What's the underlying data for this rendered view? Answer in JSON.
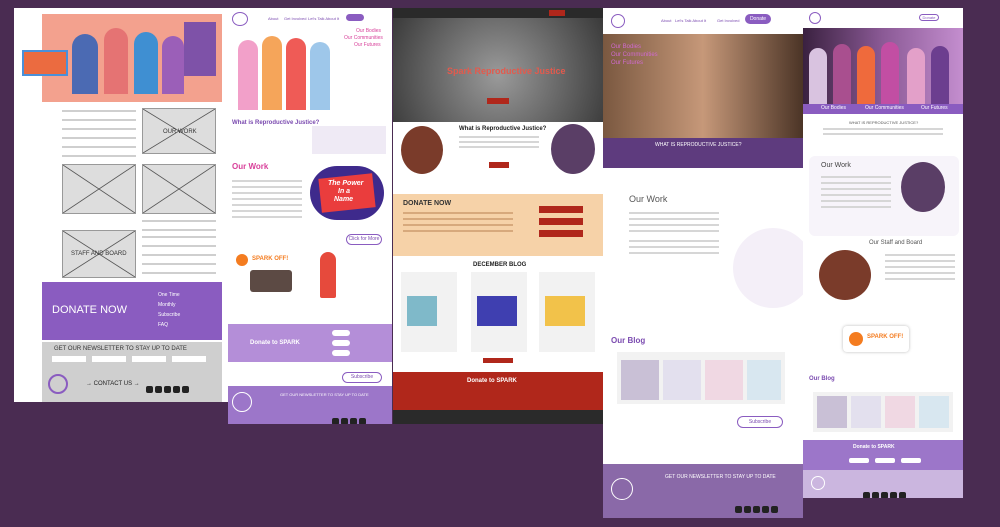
{
  "wireframe": {
    "our_work": "OUR WORK",
    "staff_board": "STAFF AND BOARD",
    "donate_now": "DONATE NOW",
    "donate_options": [
      "One Time",
      "Monthly",
      "Subscribe",
      "FAQ"
    ],
    "newsletter": "GET OUR NEWSLETTER TO STAY UP TO DATE",
    "logo": "SPARK",
    "contact": "→ CONTACT US →"
  },
  "page2": {
    "logo": "SPARK",
    "nav": [
      "About",
      "Get Involved",
      "Let's Talk About It",
      "Donate"
    ],
    "taglines": [
      "Our Bodies",
      "Our Communities",
      "Our Futures"
    ],
    "heading_rj": "What is Reproductive Justice?",
    "our_work": "Our Work",
    "power_line1": "The Power",
    "power_line2": "In a",
    "power_line3": "Name",
    "click_more": "Click for More",
    "podcast": "SPARK OFF!",
    "donate": "Donate to SPARK",
    "subscribe": "Subscribe",
    "newsletter": "GET OUR NEWSLETTER TO STAY UP TO DATE"
  },
  "page3": {
    "hero_title": "Spark Reproductive Justice",
    "heading_rj": "What is Reproductive Justice?",
    "donate_now": "DONATE NOW",
    "blog": "DECEMBER BLOG",
    "donate": "Donate to SPARK"
  },
  "page4": {
    "logo": "SPARK",
    "nav": [
      "About",
      "Let's Talk About It",
      "Get Involved"
    ],
    "donate_btn": "Donate",
    "taglines": [
      "Our Bodies",
      "Our Communities",
      "Our Futures"
    ],
    "heading_rj": "WHAT IS REPRODUCTIVE JUSTICE?",
    "our_work": "Our Work",
    "blog": "Our Blog",
    "subscribe": "Subscribe",
    "newsletter": "GET OUR NEWSLETTER TO STAY UP TO DATE"
  },
  "page5": {
    "taglines": [
      "Our Bodies",
      "Our Communities",
      "Our Futures"
    ],
    "heading_rj": "WHAT IS REPRODUCTIVE JUSTICE?",
    "our_work": "Our Work",
    "staff_board": "Our Staff and Board",
    "podcast": "SPARK OFF!",
    "blog": "Our Blog",
    "donate": "Donate to SPARK",
    "donate_btn": "Donate"
  },
  "colors": {
    "background": "#4a2c52",
    "purple": "#7b4bb0",
    "pink": "#d8409a",
    "dark_red": "#b0271b"
  }
}
